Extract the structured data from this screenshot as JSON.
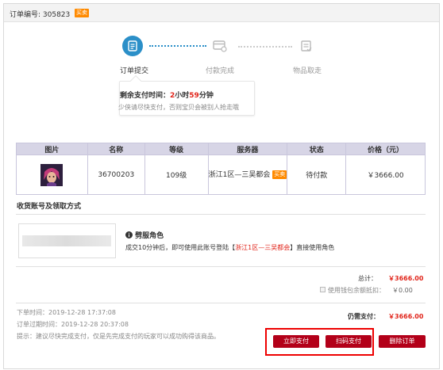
{
  "header": {
    "order_no": "订单编号: 305823",
    "badge": "买卖"
  },
  "steps": [
    {
      "label": "订单提交",
      "icon": "document-icon",
      "active": true
    },
    {
      "label": "付款完成",
      "icon": "card-icon",
      "active": false
    },
    {
      "label": "物品取走",
      "icon": "box-icon",
      "active": false
    }
  ],
  "popup": {
    "prefix": "剩余支付时间：",
    "hours": "2",
    "hours_unit": "小时",
    "minutes": "59",
    "minutes_unit": "分钟",
    "note": "少侠请尽快支付，否则宝贝会被别人抢走哦"
  },
  "table": {
    "headers": [
      "图片",
      "名称",
      "等级",
      "服务器",
      "状态",
      "价格（元）"
    ],
    "row": {
      "name": "36700203",
      "level": "109级",
      "server": "浙江1区—三吴都会",
      "server_badge": "买卖",
      "status": "待付款",
      "price": "￥3666.00"
    }
  },
  "section": {
    "title": "收货账号及领取方式"
  },
  "account": {
    "info_title": "劈服角色",
    "info_pre": "成交10分钟后，即可使用此账号登陆【",
    "info_server": "浙江1区—三吴都会",
    "info_post": "】直接使用角色"
  },
  "totals": {
    "total_label": "总计：",
    "total_value": "￥3666.00",
    "wallet_label": "使用钱包余额抵扣：",
    "wallet_value": "￥0.00",
    "need_label": "仍需支付：",
    "need_value": "￥3666.00"
  },
  "meta": {
    "order_time": "下单时间：2019-12-28 17:37:08",
    "expire_time": "订单过期时间：2019-12-28 20:37:08",
    "tip": "提示：建议尽快完成支付，仅是先完成支付的玩家可以成功购得该商品。"
  },
  "buttons": {
    "pay_now": "立即支付",
    "scan_pay": "扫码支付",
    "delete": "删除订单"
  },
  "colors": {
    "accent_blue": "#2b8fc8",
    "button_red": "#b30019",
    "price_red": "#e1251b",
    "table_header": "#d7d5e6",
    "badge_orange": "#ff8a00"
  }
}
